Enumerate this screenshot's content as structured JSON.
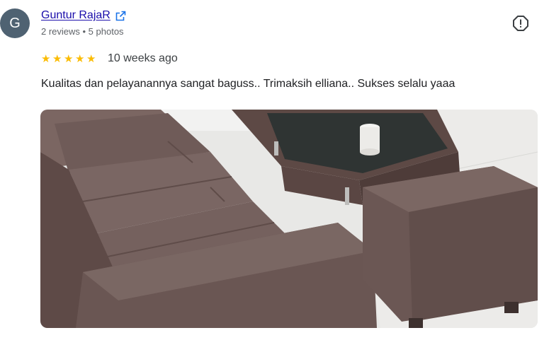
{
  "reviewer": {
    "initial": "G",
    "name": "Guntur RajaR",
    "meta": "2 reviews • 5 photos"
  },
  "review": {
    "rating": 5,
    "time": "10 weeks ago",
    "text": "Kualitas dan pelayanannya sangat baguss.. Trimaksih elliana.. Sukses selalu yaaa"
  },
  "icons": {
    "external": "external-link-icon",
    "more": "report-icon",
    "star": "star-icon"
  },
  "colors": {
    "avatar_bg": "#4f6272",
    "link": "#1a0dab",
    "star": "#fbbc04",
    "sofa": "#6d5855"
  }
}
